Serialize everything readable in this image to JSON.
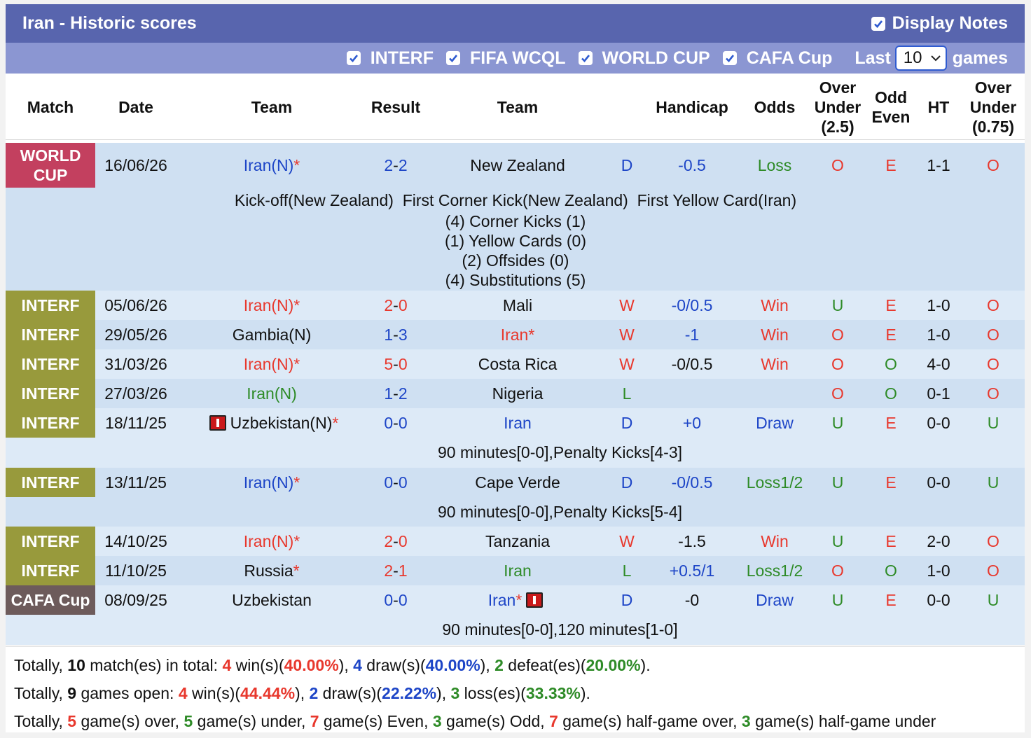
{
  "header": {
    "title": "Iran - Historic scores",
    "display_notes_label": "Display Notes",
    "display_notes_checked": true
  },
  "filters": {
    "items": [
      {
        "label": "INTERF",
        "checked": true
      },
      {
        "label": "FIFA WCQL",
        "checked": true
      },
      {
        "label": "WORLD CUP",
        "checked": true
      },
      {
        "label": "CAFA Cup",
        "checked": true
      }
    ],
    "last_label": "Last",
    "last_value": "10",
    "games_label": "games"
  },
  "columns": {
    "match": "Match",
    "date": "Date",
    "team1": "Team",
    "result": "Result",
    "team2": "Team",
    "handicap": "Handicap",
    "odds": "Odds",
    "ou_line1": "Over",
    "ou_line2": "Under",
    "ou_line3": "(2.5)",
    "oe_line1": "Odd",
    "oe_line2": "Even",
    "ht": "HT",
    "ou2_line1": "Over",
    "ou2_line2": "Under",
    "ou2_line3": "(0.75)"
  },
  "matches": [
    {
      "league": "WORLD CUP",
      "date": "16/06/26",
      "team1": "Iran(N)",
      "team1_star": true,
      "team1_color": "blue",
      "score_a": "2",
      "score_b": "2",
      "score_color": "blue",
      "team2": "New Zealand",
      "team2_star": false,
      "team2_color": "dark",
      "wl": "D",
      "wl_color": "blue",
      "handicap": "-0.5",
      "hc_color": "blue",
      "odds": "Loss",
      "odds_color": "green",
      "ou": "O",
      "ou_color": "red",
      "oe": "E",
      "oe_color": "red",
      "ht": "1-1",
      "ou2": "O",
      "ou2_color": "red"
    },
    {
      "league": "INTERF",
      "date": "05/06/26",
      "team1": "Iran(N)",
      "team1_star": true,
      "team1_color": "red",
      "score_a": "2",
      "score_b": "0",
      "score_color": "red",
      "team2": "Mali",
      "team2_star": false,
      "team2_color": "dark",
      "wl": "W",
      "wl_color": "red",
      "handicap": "-0/0.5",
      "hc_color": "blue",
      "odds": "Win",
      "odds_color": "red",
      "ou": "U",
      "ou_color": "green",
      "oe": "E",
      "oe_color": "red",
      "ht": "1-0",
      "ou2": "O",
      "ou2_color": "red"
    },
    {
      "league": "INTERF",
      "date": "29/05/26",
      "team1": "Gambia(N)",
      "team1_star": false,
      "team1_color": "dark",
      "score_a": "1",
      "score_b": "3",
      "score_color": "blue",
      "team2": "Iran",
      "team2_star": true,
      "team2_color": "red",
      "wl": "W",
      "wl_color": "red",
      "handicap": "-1",
      "hc_color": "blue",
      "odds": "Win",
      "odds_color": "red",
      "ou": "O",
      "ou_color": "red",
      "oe": "E",
      "oe_color": "red",
      "ht": "1-0",
      "ou2": "O",
      "ou2_color": "red"
    },
    {
      "league": "INTERF",
      "date": "31/03/26",
      "team1": "Iran(N)",
      "team1_star": true,
      "team1_color": "red",
      "score_a": "5",
      "score_b": "0",
      "score_color": "red",
      "team2": "Costa Rica",
      "team2_star": false,
      "team2_color": "dark",
      "wl": "W",
      "wl_color": "red",
      "handicap": "-0/0.5",
      "hc_color": "dark",
      "odds": "Win",
      "odds_color": "red",
      "ou": "O",
      "ou_color": "red",
      "oe": "O",
      "oe_color": "green",
      "ht": "4-0",
      "ou2": "O",
      "ou2_color": "red"
    },
    {
      "league": "INTERF",
      "date": "27/03/26",
      "team1": "Iran(N)",
      "team1_star": false,
      "team1_color": "green",
      "score_a": "1",
      "score_b": "2",
      "score_color": "blue",
      "team2": "Nigeria",
      "team2_star": false,
      "team2_color": "dark",
      "wl": "L",
      "wl_color": "green",
      "handicap": "",
      "hc_color": "dark",
      "odds": "",
      "odds_color": "dark",
      "ou": "O",
      "ou_color": "red",
      "oe": "O",
      "oe_color": "green",
      "ht": "0-1",
      "ou2": "O",
      "ou2_color": "red"
    },
    {
      "league": "INTERF",
      "date": "18/11/25",
      "team1": "Uzbekistan(N)",
      "team1_star": true,
      "team1_color": "dark",
      "team1_flag": true,
      "score_a": "0",
      "score_b": "0",
      "score_color": "blue",
      "team2": "Iran",
      "team2_star": false,
      "team2_color": "blue",
      "wl": "D",
      "wl_color": "blue",
      "handicap": "+0",
      "hc_color": "blue",
      "odds": "Draw",
      "odds_color": "blue",
      "ou": "U",
      "ou_color": "green",
      "oe": "E",
      "oe_color": "red",
      "ht": "0-0",
      "ou2": "U",
      "ou2_color": "green",
      "note": "90 minutes[0-0],Penalty Kicks[4-3]"
    },
    {
      "league": "INTERF",
      "date": "13/11/25",
      "team1": "Iran(N)",
      "team1_star": true,
      "team1_color": "blue",
      "score_a": "0",
      "score_b": "0",
      "score_color": "blue",
      "team2": "Cape Verde",
      "team2_star": false,
      "team2_color": "dark",
      "wl": "D",
      "wl_color": "blue",
      "handicap": "-0/0.5",
      "hc_color": "blue",
      "odds": "Loss1/2",
      "odds_color": "green",
      "ou": "U",
      "ou_color": "green",
      "oe": "E",
      "oe_color": "red",
      "ht": "0-0",
      "ou2": "U",
      "ou2_color": "green",
      "note": "90 minutes[0-0],Penalty Kicks[5-4]"
    },
    {
      "league": "INTERF",
      "date": "14/10/25",
      "team1": "Iran(N)",
      "team1_star": true,
      "team1_color": "red",
      "score_a": "2",
      "score_b": "0",
      "score_color": "red",
      "team2": "Tanzania",
      "team2_star": false,
      "team2_color": "dark",
      "wl": "W",
      "wl_color": "red",
      "handicap": "-1.5",
      "hc_color": "dark",
      "odds": "Win",
      "odds_color": "red",
      "ou": "U",
      "ou_color": "green",
      "oe": "E",
      "oe_color": "red",
      "ht": "2-0",
      "ou2": "O",
      "ou2_color": "red"
    },
    {
      "league": "INTERF",
      "date": "11/10/25",
      "team1": "Russia",
      "team1_star": true,
      "team1_color": "dark",
      "score_a": "2",
      "score_b": "1",
      "score_color": "red",
      "team2": "Iran",
      "team2_star": false,
      "team2_color": "green",
      "wl": "L",
      "wl_color": "green",
      "handicap": "+0.5/1",
      "hc_color": "blue",
      "odds": "Loss1/2",
      "odds_color": "green",
      "ou": "O",
      "ou_color": "red",
      "oe": "O",
      "oe_color": "green",
      "ht": "1-0",
      "ou2": "O",
      "ou2_color": "red"
    },
    {
      "league": "CAFA Cup",
      "date": "08/09/25",
      "team1": "Uzbekistan",
      "team1_star": false,
      "team1_color": "dark",
      "score_a": "0",
      "score_b": "0",
      "score_color": "blue",
      "team2": "Iran",
      "team2_star": true,
      "team2_color": "blue",
      "team2_flag": true,
      "wl": "D",
      "wl_color": "blue",
      "handicap": "-0",
      "hc_color": "dark",
      "odds": "Draw",
      "odds_color": "blue",
      "ou": "U",
      "ou_color": "green",
      "oe": "E",
      "oe_color": "red",
      "ht": "0-0",
      "ou2": "U",
      "ou2_color": "green",
      "note": "90 minutes[0-0],120 minutes[1-0]"
    }
  ],
  "first_match_notes": {
    "line1": "Kick-off(New Zealand)  First Corner Kick(New Zealand)  First Yellow Card(Iran)",
    "line2": "(4) Corner Kicks (1)",
    "line3": "(1) Yellow Cards (0)",
    "line4": "(2) Offsides (0)",
    "line5": "(4) Substitutions (5)"
  },
  "summary": {
    "line1": [
      {
        "t": "Totally, ",
        "c": "dark"
      },
      {
        "t": "10",
        "c": "dark",
        "b": true
      },
      {
        "t": " match(es) in total: ",
        "c": "dark"
      },
      {
        "t": "4",
        "c": "red",
        "b": true
      },
      {
        "t": " win(s)(",
        "c": "dark"
      },
      {
        "t": "40.00%",
        "c": "red",
        "b": true
      },
      {
        "t": "), ",
        "c": "dark"
      },
      {
        "t": "4",
        "c": "blue",
        "b": true
      },
      {
        "t": " draw(s)(",
        "c": "dark"
      },
      {
        "t": "40.00%",
        "c": "blue",
        "b": true
      },
      {
        "t": "), ",
        "c": "dark"
      },
      {
        "t": "2",
        "c": "green",
        "b": true
      },
      {
        "t": " defeat(es)(",
        "c": "dark"
      },
      {
        "t": "20.00%",
        "c": "green",
        "b": true
      },
      {
        "t": ").",
        "c": "dark"
      }
    ],
    "line2": [
      {
        "t": "Totally, ",
        "c": "dark"
      },
      {
        "t": "9",
        "c": "dark",
        "b": true
      },
      {
        "t": " games open: ",
        "c": "dark"
      },
      {
        "t": "4",
        "c": "red",
        "b": true
      },
      {
        "t": " win(s)(",
        "c": "dark"
      },
      {
        "t": "44.44%",
        "c": "red",
        "b": true
      },
      {
        "t": "), ",
        "c": "dark"
      },
      {
        "t": "2",
        "c": "blue",
        "b": true
      },
      {
        "t": " draw(s)(",
        "c": "dark"
      },
      {
        "t": "22.22%",
        "c": "blue",
        "b": true
      },
      {
        "t": "), ",
        "c": "dark"
      },
      {
        "t": "3",
        "c": "green",
        "b": true
      },
      {
        "t": " loss(es)(",
        "c": "dark"
      },
      {
        "t": "33.33%",
        "c": "green",
        "b": true
      },
      {
        "t": ").",
        "c": "dark"
      }
    ],
    "line3": [
      {
        "t": "Totally, ",
        "c": "dark"
      },
      {
        "t": "5",
        "c": "red",
        "b": true
      },
      {
        "t": " game(s) over, ",
        "c": "dark"
      },
      {
        "t": "5",
        "c": "green",
        "b": true
      },
      {
        "t": " game(s) under, ",
        "c": "dark"
      },
      {
        "t": "7",
        "c": "red",
        "b": true
      },
      {
        "t": " game(s) Even, ",
        "c": "dark"
      },
      {
        "t": "3",
        "c": "green",
        "b": true
      },
      {
        "t": " game(s) Odd, ",
        "c": "dark"
      },
      {
        "t": "7",
        "c": "red",
        "b": true
      },
      {
        "t": " game(s) half-game over, ",
        "c": "dark"
      },
      {
        "t": "3",
        "c": "green",
        "b": true
      },
      {
        "t": " game(s) half-game under",
        "c": "dark"
      }
    ]
  }
}
